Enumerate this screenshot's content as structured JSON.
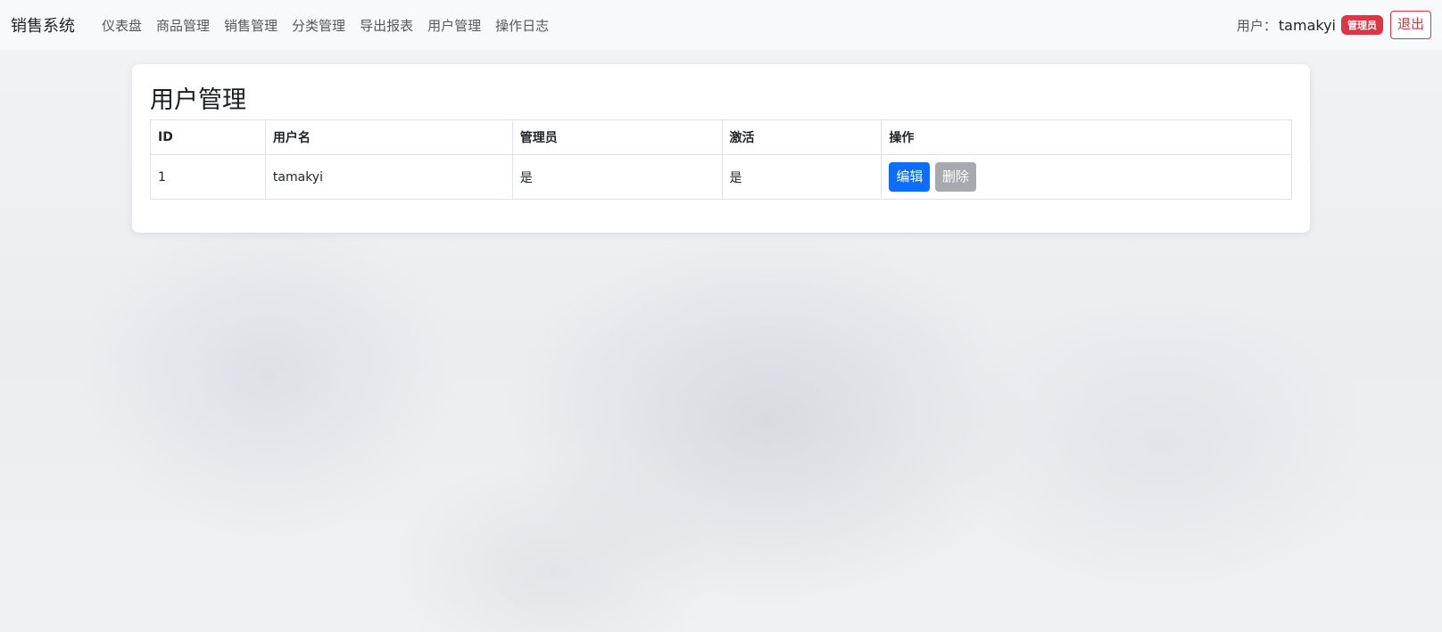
{
  "navbar": {
    "brand": "销售系统",
    "links": [
      {
        "label": "仪表盘"
      },
      {
        "label": "商品管理"
      },
      {
        "label": "销售管理"
      },
      {
        "label": "分类管理"
      },
      {
        "label": "导出报表"
      },
      {
        "label": "用户管理"
      },
      {
        "label": "操作日志"
      }
    ],
    "user_label": "用户：",
    "username": "tamakyi",
    "role_badge": "管理员",
    "logout_label": "退出"
  },
  "main": {
    "title": "用户管理",
    "table": {
      "headers": [
        "ID",
        "用户名",
        "管理员",
        "激活",
        "操作"
      ],
      "rows": [
        {
          "id": "1",
          "username": "tamakyi",
          "is_admin": "是",
          "is_active": "是",
          "actions": {
            "edit": "编辑",
            "delete": "删除"
          }
        }
      ]
    }
  },
  "colors": {
    "primary": "#0d6efd",
    "danger": "#dc3545",
    "secondary": "#a6a9ad"
  }
}
